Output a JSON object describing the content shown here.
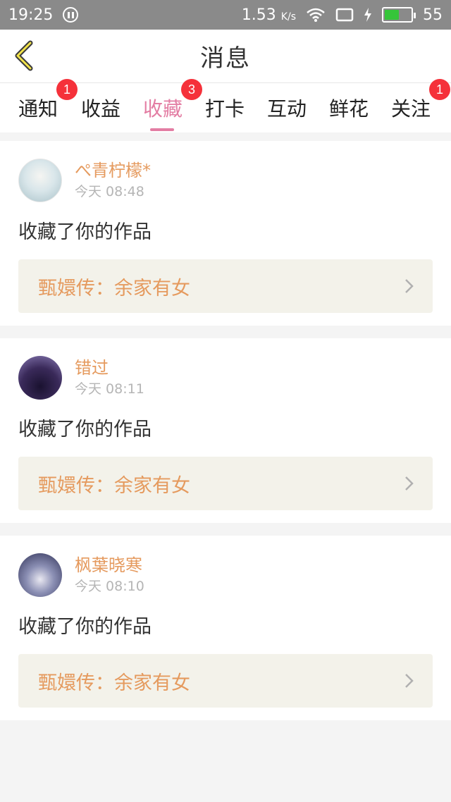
{
  "status_bar": {
    "time": "19:25",
    "net_speed": "1.53",
    "net_unit": "K/s",
    "battery": "55",
    "battery_level": 0.55
  },
  "header": {
    "title": "消息"
  },
  "tabs": [
    {
      "label": "通知",
      "badge": "1"
    },
    {
      "label": "收益",
      "badge": ""
    },
    {
      "label": "收藏",
      "badge": "3"
    },
    {
      "label": "打卡",
      "badge": ""
    },
    {
      "label": "互动",
      "badge": ""
    },
    {
      "label": "鲜花",
      "badge": ""
    },
    {
      "label": "关注",
      "badge": "1"
    }
  ],
  "active_tab": "收藏",
  "colors": {
    "accent": "#e37da3",
    "name": "#e59a5e",
    "badge": "#f5313a"
  },
  "messages": [
    {
      "username": "ぺ青柠檬*",
      "time": "今天 08:48",
      "action": "收藏了你的作品",
      "work": "甄嬛传：余家有女"
    },
    {
      "username": "错过",
      "time": "今天 08:11",
      "action": "收藏了你的作品",
      "work": "甄嬛传：余家有女"
    },
    {
      "username": "枫葉晓寒",
      "time": "今天 08:10",
      "action": "收藏了你的作品",
      "work": "甄嬛传：余家有女"
    }
  ]
}
